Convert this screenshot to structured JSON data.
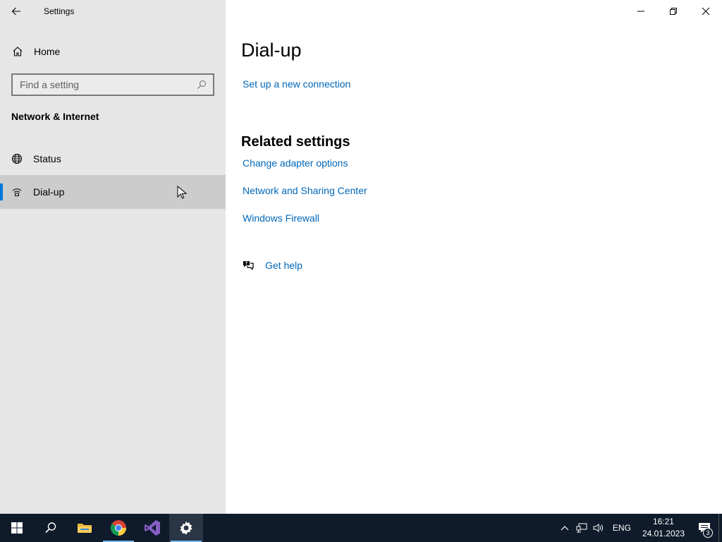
{
  "window": {
    "title": "Settings"
  },
  "sidebar": {
    "home_label": "Home",
    "search_placeholder": "Find a setting",
    "section_title": "Network & Internet",
    "items": [
      {
        "label": "Status",
        "icon": "globe-icon"
      },
      {
        "label": "Dial-up",
        "icon": "dialup-icon",
        "selected": true
      }
    ]
  },
  "main": {
    "title": "Dial-up",
    "setup_link": "Set up a new connection",
    "related_title": "Related settings",
    "related_links": [
      "Change adapter options",
      "Network and Sharing Center",
      "Windows Firewall"
    ],
    "help_label": "Get help"
  },
  "taskbar": {
    "apps": [
      "start-icon",
      "search-icon",
      "file-explorer-icon",
      "chrome-icon",
      "visual-studio-icon",
      "settings-icon"
    ],
    "tray": {
      "language": "ENG",
      "time": "16:21",
      "date": "24.01.2023",
      "notification_count": "3"
    }
  },
  "colors": {
    "accent": "#0078d7",
    "link": "#0067b8",
    "sidebar_bg": "#e6e6e6",
    "selected_bg": "#cccccc",
    "taskbar_bg": "#0f1a2a"
  }
}
